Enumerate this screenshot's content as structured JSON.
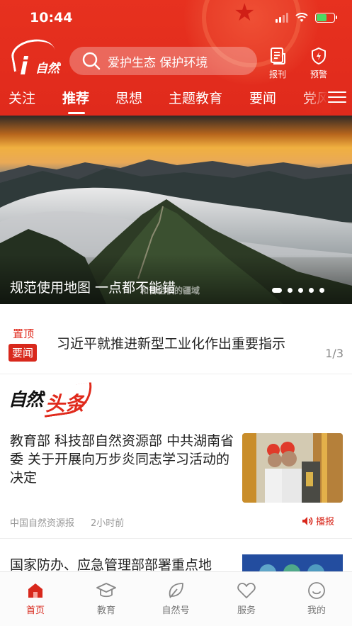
{
  "status_bar": {
    "time": "10:44"
  },
  "header": {
    "logo_text": "自然",
    "search_placeholder": "爱护生态 保护环境",
    "buttons": [
      {
        "label": "报刊",
        "icon": "newspaper-icon"
      },
      {
        "label": "预警",
        "icon": "warning-shield-icon"
      }
    ],
    "tabs": [
      "关注",
      "推荐",
      "思想",
      "主题教育",
      "要闻",
      "党风"
    ],
    "active_tab": "推荐"
  },
  "banner": {
    "title": "规范使用地图 一点都不能错",
    "watermark": "和普祖权的疆域",
    "slide_count": 5,
    "active_slide": 1
  },
  "pinned": {
    "pin_label": "置顶",
    "badge": "要闻",
    "title": "习近平就推进新型工业化作出重要指示",
    "counter": "1/3"
  },
  "section": {
    "logo_part1": "自然",
    "logo_part2": "头条"
  },
  "article": {
    "title": "教育部 科技部自然资源部 中共湖南省委 关于开展向万步炎同志学习活动的决定",
    "source": "中国自然资源报",
    "time": "2小时前",
    "play_label": "播报"
  },
  "article2": {
    "title": "国家防办、应急管理部部署重点地"
  },
  "bottom_nav": [
    {
      "label": "首页",
      "icon": "home-icon",
      "active": true
    },
    {
      "label": "教育",
      "icon": "graduation-cap-icon",
      "active": false
    },
    {
      "label": "自然号",
      "icon": "leaf-icon",
      "active": false
    },
    {
      "label": "服务",
      "icon": "heart-icon",
      "active": false
    },
    {
      "label": "我的",
      "icon": "smiley-icon",
      "active": false
    }
  ],
  "colors": {
    "brand_red": "#e02a1c",
    "text": "#222222",
    "muted": "#999999"
  }
}
